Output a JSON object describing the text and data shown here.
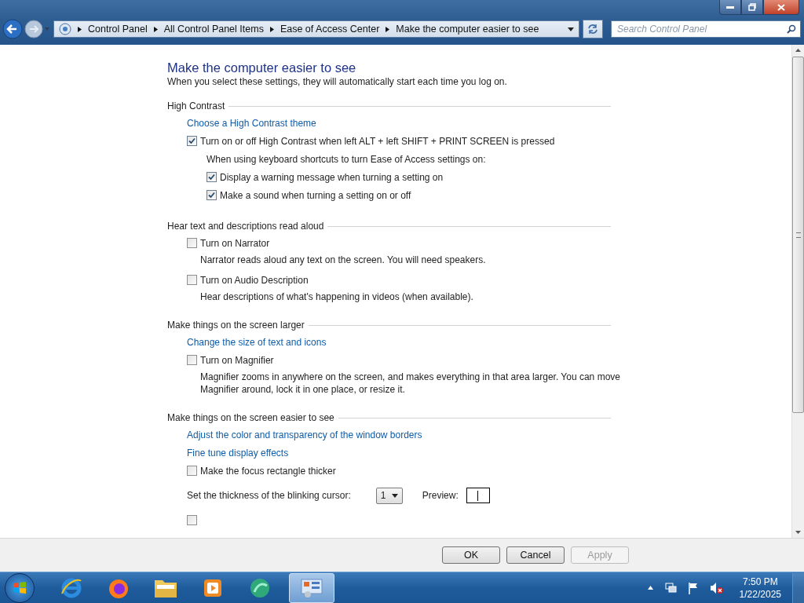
{
  "breadcrumb": [
    "Control Panel",
    "All Control Panel Items",
    "Ease of Access Center",
    "Make the computer easier to see"
  ],
  "search": {
    "placeholder": "Search Control Panel"
  },
  "page": {
    "title": "Make the computer easier to see",
    "subtitle": "When you select these settings, they will automatically start each time you log on."
  },
  "sections": [
    {
      "title": "High Contrast",
      "items": [
        {
          "kind": "link",
          "label": "Choose a High Contrast theme"
        },
        {
          "kind": "checkbox",
          "label": "Turn on or off High Contrast when left ALT + left SHIFT + PRINT SCREEN is pressed",
          "checked": true
        },
        {
          "kind": "group",
          "label": "When using keyboard shortcuts to turn Ease of Access settings on:",
          "children": [
            {
              "kind": "checkbox",
              "label": "Display a warning message when turning a setting on",
              "checked": true
            },
            {
              "kind": "checkbox",
              "label": "Make a sound when turning a setting on or off",
              "checked": true
            }
          ]
        }
      ]
    },
    {
      "title": "Hear text and descriptions read aloud",
      "items": [
        {
          "kind": "checkbox",
          "label": "Turn on Narrator",
          "checked": false,
          "description": "Narrator reads aloud any text on the screen. You will need speakers."
        },
        {
          "kind": "checkbox",
          "label": "Turn on Audio Description",
          "checked": false,
          "description": "Hear descriptions of what's happening in videos (when available)."
        }
      ]
    },
    {
      "title": "Make things on the screen larger",
      "items": [
        {
          "kind": "link",
          "label": "Change the size of text and icons"
        },
        {
          "kind": "checkbox",
          "label": "Turn on Magnifier",
          "checked": false,
          "description": "Magnifier zooms in anywhere on the screen, and makes everything in that area larger. You can move Magnifier around, lock it in one place, or resize it."
        }
      ]
    },
    {
      "title": "Make things on the screen easier to see",
      "items": [
        {
          "kind": "link",
          "label": "Adjust the color and transparency of the window borders"
        },
        {
          "kind": "link",
          "label": "Fine tune display effects"
        },
        {
          "kind": "checkbox",
          "label": "Make the focus rectangle thicker",
          "checked": false
        },
        {
          "kind": "cursor",
          "label": "Set the thickness of the blinking cursor:",
          "value": "1",
          "preview_label": "Preview:"
        },
        {
          "kind": "checkbox",
          "checked": false
        }
      ]
    }
  ],
  "buttons": [
    {
      "label": "OK",
      "disabled": false
    },
    {
      "label": "Cancel",
      "disabled": false
    },
    {
      "label": "Apply",
      "disabled": true
    }
  ],
  "clock": {
    "time": "7:50 PM",
    "date": "1/22/2025"
  }
}
